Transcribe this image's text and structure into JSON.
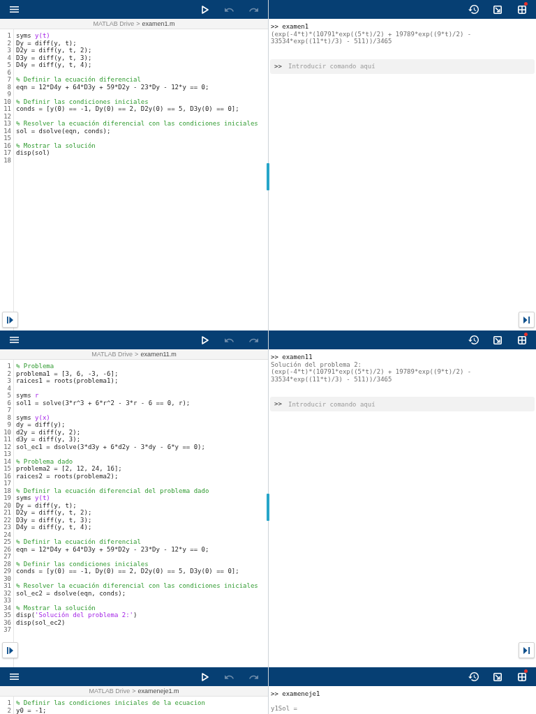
{
  "screens": [
    {
      "editor": {
        "toolbar": [
          {
            "kind": "menu",
            "disabled": false
          },
          {
            "kind": "run",
            "disabled": false
          },
          {
            "kind": "undo",
            "disabled": true
          },
          {
            "kind": "redo",
            "disabled": true
          }
        ],
        "breadcrumb": {
          "root": "MATLAB Drive",
          "separator": ">",
          "file": "examen1.m"
        },
        "lines": [
          {
            "number": "1",
            "segments": [
              {
                "kind": "code",
                "text": "syms "
              },
              {
                "kind": "symbolic",
                "text": "y(t)"
              }
            ]
          },
          {
            "number": "2",
            "segments": [
              {
                "kind": "code",
                "text": "Dy = diff(y, t);"
              }
            ]
          },
          {
            "number": "3",
            "segments": [
              {
                "kind": "code",
                "text": "D2y = diff(y, t, 2);"
              }
            ]
          },
          {
            "number": "4",
            "segments": [
              {
                "kind": "code",
                "text": "D3y = diff(y, t, 3);"
              }
            ]
          },
          {
            "number": "5",
            "segments": [
              {
                "kind": "code",
                "text": "D4y = diff(y, t, 4);"
              }
            ]
          },
          {
            "number": "6"
          },
          {
            "number": "7",
            "segments": [
              {
                "kind": "comment",
                "text": "% Definir la ecuación diferencial"
              }
            ]
          },
          {
            "number": "8",
            "segments": [
              {
                "kind": "code",
                "text": "eqn = 12*D4y + 64*D3y + 59*D2y - 23*Dy - 12*y == 0;"
              }
            ]
          },
          {
            "number": "9"
          },
          {
            "number": "10",
            "segments": [
              {
                "kind": "comment",
                "text": "% Definir las condiciones iniciales"
              }
            ]
          },
          {
            "number": "11",
            "segments": [
              {
                "kind": "code",
                "text": "conds = [y(0) == -1, Dy(0) == 2, D2y(0) == 5, D3y(0) == 0];"
              }
            ]
          },
          {
            "number": "12"
          },
          {
            "number": "13",
            "segments": [
              {
                "kind": "comment",
                "text": "% Resolver la ecuación diferencial con las condiciones iniciales"
              }
            ]
          },
          {
            "number": "14",
            "segments": [
              {
                "kind": "code",
                "text": "sol = dsolve(eqn, conds);"
              }
            ]
          },
          {
            "number": "15"
          },
          {
            "number": "16",
            "segments": [
              {
                "kind": "comment",
                "text": "% Mostrar la solución"
              }
            ]
          },
          {
            "number": "17",
            "segments": [
              {
                "kind": "code",
                "text": "disp(sol)"
              }
            ]
          },
          {
            "number": "18"
          }
        ]
      },
      "command_window": {
        "toolbar": [
          {
            "kind": "history",
            "notification": false
          },
          {
            "kind": "undock",
            "notification": false
          },
          {
            "kind": "layout",
            "notification": true
          }
        ],
        "entries": [
          {
            "kind": "command",
            "text": ">> examen1"
          },
          {
            "kind": "output",
            "text": "(exp(-4*t)*(10791*exp((5*t)/2) + 19789*exp((9*t)/2) - 33534*exp((11*t)/3) - 511))/3465"
          }
        ],
        "input": {
          "prompt": ">>",
          "placeholder": "Introducir comando aquí"
        }
      }
    },
    {
      "editor": {
        "toolbar": [
          {
            "kind": "menu",
            "disabled": false
          },
          {
            "kind": "run",
            "disabled": false
          },
          {
            "kind": "undo",
            "disabled": true
          },
          {
            "kind": "redo",
            "disabled": true
          }
        ],
        "breadcrumb": {
          "root": "MATLAB Drive",
          "separator": ">",
          "file": "examen11.m"
        },
        "lines": [
          {
            "number": "1",
            "segments": [
              {
                "kind": "comment",
                "text": "% Problema"
              }
            ]
          },
          {
            "number": "2",
            "segments": [
              {
                "kind": "code",
                "text": "problema1 = [3, 6, -3, -6];"
              }
            ]
          },
          {
            "number": "3",
            "segments": [
              {
                "kind": "code",
                "text": "raices1 = roots(problema1);"
              }
            ]
          },
          {
            "number": "4"
          },
          {
            "number": "5",
            "segments": [
              {
                "kind": "code",
                "text": "syms "
              },
              {
                "kind": "symbolic",
                "text": "r"
              }
            ]
          },
          {
            "number": "6",
            "segments": [
              {
                "kind": "code",
                "text": "sol1 = solve(3*r^3 + 6*r^2 - 3*r - 6 == 0, r);"
              }
            ]
          },
          {
            "number": "7"
          },
          {
            "number": "8",
            "segments": [
              {
                "kind": "code",
                "text": "syms "
              },
              {
                "kind": "symbolic",
                "text": "y(x)"
              }
            ]
          },
          {
            "number": "9",
            "segments": [
              {
                "kind": "code",
                "text": "dy = diff(y);"
              }
            ]
          },
          {
            "number": "10",
            "segments": [
              {
                "kind": "code",
                "text": "d2y = diff(y, 2);"
              }
            ]
          },
          {
            "number": "11",
            "segments": [
              {
                "kind": "code",
                "text": "d3y = diff(y, 3);"
              }
            ]
          },
          {
            "number": "12",
            "segments": [
              {
                "kind": "code",
                "text": "sol_ec1 = dsolve(3*d3y + 6*d2y - 3*dy - 6*y == 0);"
              }
            ]
          },
          {
            "number": "13"
          },
          {
            "number": "14",
            "segments": [
              {
                "kind": "comment",
                "text": "% Problema dado"
              }
            ]
          },
          {
            "number": "15",
            "segments": [
              {
                "kind": "code",
                "text": "problema2 = [2, 12, 24, 16];"
              }
            ]
          },
          {
            "number": "16",
            "segments": [
              {
                "kind": "code",
                "text": "raices2 = roots(problema2);"
              }
            ]
          },
          {
            "number": "17"
          },
          {
            "number": "18",
            "segments": [
              {
                "kind": "comment",
                "text": "% Definir la ecuación diferencial del problema dado"
              }
            ]
          },
          {
            "number": "19",
            "segments": [
              {
                "kind": "code",
                "text": "syms "
              },
              {
                "kind": "symbolic",
                "text": "y(t)"
              }
            ]
          },
          {
            "number": "20",
            "segments": [
              {
                "kind": "code",
                "text": "Dy = diff(y, t);"
              }
            ]
          },
          {
            "number": "21",
            "segments": [
              {
                "kind": "code",
                "text": "D2y = diff(y, t, 2);"
              }
            ]
          },
          {
            "number": "22",
            "segments": [
              {
                "kind": "code",
                "text": "D3y = diff(y, t, 3);"
              }
            ]
          },
          {
            "number": "23",
            "segments": [
              {
                "kind": "code",
                "text": "D4y = diff(y, t, 4);"
              }
            ]
          },
          {
            "number": "24"
          },
          {
            "number": "25",
            "segments": [
              {
                "kind": "comment",
                "text": "% Definir la ecuación diferencial"
              }
            ]
          },
          {
            "number": "26",
            "segments": [
              {
                "kind": "code",
                "text": "eqn = 12*D4y + 64*D3y + 59*D2y - 23*Dy - 12*y == 0;"
              }
            ]
          },
          {
            "number": "27"
          },
          {
            "number": "28",
            "segments": [
              {
                "kind": "comment",
                "text": "% Definir las condiciones iniciales"
              }
            ]
          },
          {
            "number": "29",
            "segments": [
              {
                "kind": "code",
                "text": "conds = [y(0) == -1, Dy(0) == 2, D2y(0) == 5, D3y(0) == 0];"
              }
            ]
          },
          {
            "number": "30"
          },
          {
            "number": "31",
            "segments": [
              {
                "kind": "comment",
                "text": "% Resolver la ecuación diferencial con las condiciones iniciales"
              }
            ]
          },
          {
            "number": "32",
            "segments": [
              {
                "kind": "code",
                "text": "sol_ec2 = dsolve(eqn, conds);"
              }
            ]
          },
          {
            "number": "33"
          },
          {
            "number": "34",
            "segments": [
              {
                "kind": "comment",
                "text": "% Mostrar la solución"
              }
            ]
          },
          {
            "number": "35",
            "segments": [
              {
                "kind": "code",
                "text": "disp("
              },
              {
                "kind": "string",
                "text": "'Solución del problema 2:'"
              },
              {
                "kind": "code",
                "text": ")"
              }
            ]
          },
          {
            "number": "36",
            "segments": [
              {
                "kind": "code",
                "text": "disp(sol_ec2)"
              }
            ]
          },
          {
            "number": "37"
          }
        ]
      },
      "command_window": {
        "toolbar": [
          {
            "kind": "history",
            "notification": false
          },
          {
            "kind": "undock",
            "notification": false
          },
          {
            "kind": "layout",
            "notification": true
          }
        ],
        "entries": [
          {
            "kind": "command",
            "text": ">> examen11"
          },
          {
            "kind": "output",
            "text": "Solución del problema 2:"
          },
          {
            "kind": "output",
            "text": "(exp(-4*t)*(10791*exp((5*t)/2) + 19789*exp((9*t)/2) - 33534*exp((11*t)/3) - 511))/3465"
          }
        ],
        "input": {
          "prompt": ">>",
          "placeholder": "Introducir comando aquí"
        }
      }
    },
    {
      "editor": {
        "toolbar": [
          {
            "kind": "menu",
            "disabled": false
          },
          {
            "kind": "run",
            "disabled": false
          },
          {
            "kind": "undo",
            "disabled": true
          },
          {
            "kind": "redo",
            "disabled": true
          }
        ],
        "breadcrumb": {
          "root": "MATLAB Drive",
          "separator": ">",
          "file": "exameneje1.m"
        },
        "lines": [
          {
            "number": "1",
            "segments": [
              {
                "kind": "comment",
                "text": "% Definir las condiciones iniciales de la ecuacion"
              }
            ]
          },
          {
            "number": "2",
            "segments": [
              {
                "kind": "code",
                "text": "y0 = -1;"
              }
            ]
          }
        ]
      },
      "command_window": {
        "toolbar": [
          {
            "kind": "history",
            "notification": false
          },
          {
            "kind": "undock",
            "notification": false
          },
          {
            "kind": "layout",
            "notification": true
          }
        ],
        "entries": [
          {
            "kind": "command",
            "text": ">> exameneje1"
          },
          {
            "kind": "display",
            "text": "y1Sol ="
          }
        ]
      }
    }
  ]
}
